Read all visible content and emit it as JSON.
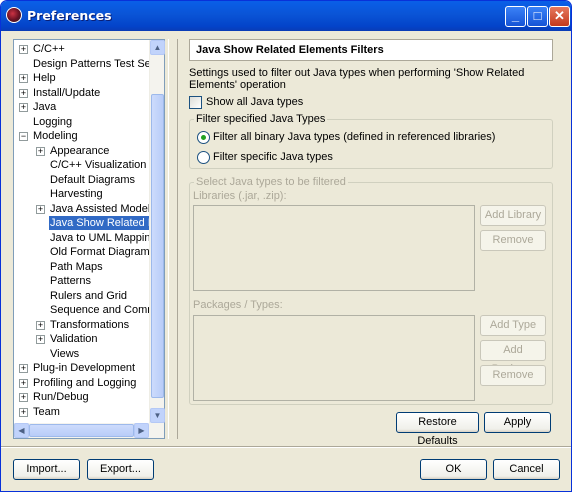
{
  "window": {
    "title": "Preferences",
    "controls": {
      "minimize": "_",
      "maximize": "□",
      "close": "✕"
    }
  },
  "tree": {
    "items": [
      {
        "label": "C/C++",
        "level": 0,
        "expander": "+"
      },
      {
        "label": "Design Patterns Test Setup",
        "level": 0,
        "expander": ""
      },
      {
        "label": "Help",
        "level": 0,
        "expander": "+"
      },
      {
        "label": "Install/Update",
        "level": 0,
        "expander": "+"
      },
      {
        "label": "Java",
        "level": 0,
        "expander": "+"
      },
      {
        "label": "Logging",
        "level": 0,
        "expander": ""
      },
      {
        "label": "Modeling",
        "level": 0,
        "expander": "−"
      },
      {
        "label": "Appearance",
        "level": 1,
        "expander": "+"
      },
      {
        "label": "C/C++ Visualization",
        "level": 1,
        "expander": ""
      },
      {
        "label": "Default Diagrams",
        "level": 1,
        "expander": ""
      },
      {
        "label": "Harvesting",
        "level": 1,
        "expander": ""
      },
      {
        "label": "Java Assisted Modeling",
        "level": 1,
        "expander": "+"
      },
      {
        "label": "Java Show Related Elements",
        "level": 1,
        "expander": "",
        "selected": true
      },
      {
        "label": "Java to UML Mapping",
        "level": 1,
        "expander": ""
      },
      {
        "label": "Old Format Diagrams H",
        "level": 1,
        "expander": ""
      },
      {
        "label": "Path Maps",
        "level": 1,
        "expander": ""
      },
      {
        "label": "Patterns",
        "level": 1,
        "expander": ""
      },
      {
        "label": "Rulers and Grid",
        "level": 1,
        "expander": ""
      },
      {
        "label": "Sequence and Commun",
        "level": 1,
        "expander": ""
      },
      {
        "label": "Transformations",
        "level": 1,
        "expander": "+"
      },
      {
        "label": "Validation",
        "level": 1,
        "expander": "+"
      },
      {
        "label": "Views",
        "level": 1,
        "expander": ""
      },
      {
        "label": "Plug-in Development",
        "level": 0,
        "expander": "+"
      },
      {
        "label": "Profiling and Logging",
        "level": 0,
        "expander": "+"
      },
      {
        "label": "Run/Debug",
        "level": 0,
        "expander": "+"
      },
      {
        "label": "Team",
        "level": 0,
        "expander": "+"
      }
    ]
  },
  "page": {
    "header": "Java Show Related Elements Filters",
    "description": "Settings used to filter out Java types when performing 'Show Related Elements' operation",
    "show_all_label": "Show all Java types",
    "filter_group": {
      "title": "Filter specified Java Types",
      "option_binary": "Filter all binary Java types (defined in referenced libraries)",
      "option_specific": "Filter specific Java types",
      "selected": "binary"
    },
    "select_group": {
      "title": "Select Java types to be filtered",
      "libraries_label": "Libraries (.jar, .zip):",
      "add_library": "Add Library",
      "remove_library": "Remove",
      "packages_label": "Packages / Types:",
      "add_type": "Add Type",
      "add_package": "Add Package",
      "remove_package": "Remove"
    },
    "restore_defaults": "Restore Defaults",
    "apply": "Apply"
  },
  "footer": {
    "import": "Import...",
    "export": "Export...",
    "ok": "OK",
    "cancel": "Cancel"
  }
}
